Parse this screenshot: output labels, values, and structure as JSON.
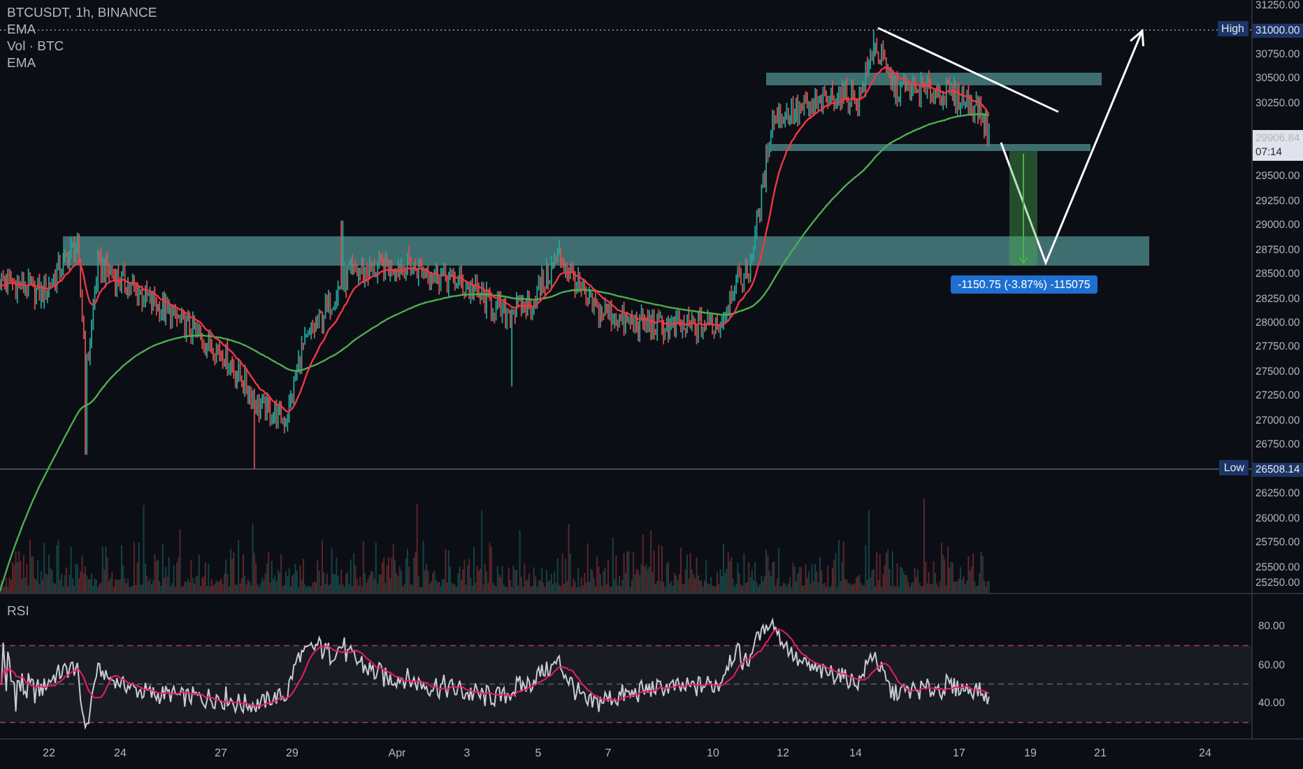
{
  "legend": [
    "BTCUSDT, 1h, BINANCE",
    "EMA",
    "Vol · BTC",
    "EMA"
  ],
  "high": {
    "label": "High",
    "value": "31000.00"
  },
  "low": {
    "label": "Low",
    "value": "26508.14"
  },
  "current_price": {
    "price": "29906.84",
    "countdown": "07:14"
  },
  "measure": {
    "label": "-1150.75 (-3.87%) -115075"
  },
  "price_axis": [
    "31250.00",
    "30750.00",
    "30500.00",
    "30250.00",
    "29500.00",
    "29250.00",
    "29000.00",
    "28750.00",
    "28500.00",
    "28250.00",
    "28000.00",
    "27750.00",
    "27500.00",
    "27250.00",
    "27000.00",
    "26750.00",
    "26250.00",
    "26000.00",
    "25750.00",
    "25500.00",
    "25250.00"
  ],
  "rsi": {
    "label": "RSI",
    "axis": [
      "80.00",
      "60.00",
      "40.00"
    ]
  },
  "time_axis": [
    "22",
    "24",
    "27",
    "29",
    "Apr",
    "3",
    "5",
    "7",
    "10",
    "12",
    "14",
    "17",
    "19",
    "21",
    "24"
  ]
}
